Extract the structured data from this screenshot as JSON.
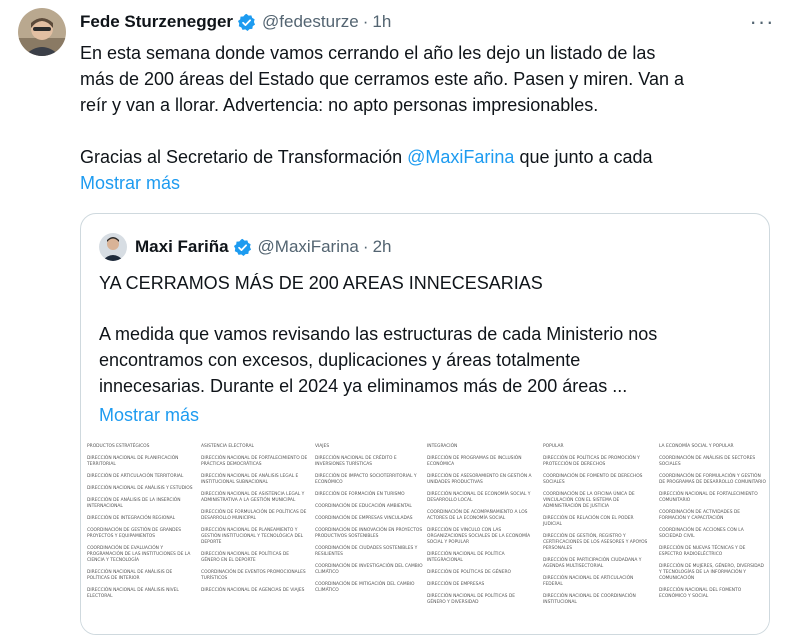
{
  "tweet": {
    "author_name": "Fede Sturzenegger",
    "handle": "@fedesturze",
    "time": "1h",
    "text_lines": [
      "En esta semana donde vamos cerrando el año les dejo un listado de las",
      "más de 200 áreas del Estado que cerramos este año. Pasen y miren. Van a",
      "reír y van a  llorar. Advertencia: no apto personas impresionables."
    ],
    "thanks_prefix": "Gracias al Secretario de Transformación ",
    "thanks_mention": "@MaxiFarina",
    "thanks_suffix": " que junto a cada",
    "show_more": "Mostrar más"
  },
  "quote": {
    "author_name": "Maxi Fariña",
    "handle": "@MaxiFarina",
    "time": "2h",
    "title": "YA CERRAMOS MÁS DE 200 AREAS INNECESARIAS",
    "body_lines": [
      "A medida que vamos revisando las estructuras de cada Ministerio nos",
      "encontramos con excesos, duplicaciones y áreas totalmente",
      "innecesarias. Durante el 2024 ya eliminamos más de 200 áreas ..."
    ],
    "show_more": "Mostrar más"
  },
  "image_columns": [
    [
      "Productos estratégicos",
      "Dirección nacional de planificación territorial",
      "Dirección de articulación territorial",
      "Dirección nacional de análisis y estudios",
      "Dirección de análisis de la inserción internacional",
      "Dirección de integración regional",
      "Coordinación de gestión de grandes proyectos y equipamientos",
      "Coordinación de evaluación y programación de las instituciones de la ciencia y tecnología",
      "Dirección nacional de análisis de políticas de interior",
      "Dirección nacional de análisis nivel electoral"
    ],
    [
      "Asistencia electoral",
      "Dirección nacional de fortalecimiento de prácticas democráticas",
      "Dirección nacional de análisis legal e institucional subnacional",
      "Dirección nacional de asistencia legal y administrativa a la gestión municipal",
      "Dirección de formulación de políticas de desarrollo municipal",
      "Dirección nacional de planeamiento y gestión institucional y tecnológica del deporte",
      "Dirección nacional de políticas de género en el deporte",
      "Coordinación de eventos promocionales turísticos",
      "Dirección nacional de agencias de viajes"
    ],
    [
      "Viajes",
      "Dirección nacional de crédito e inversiones turísticas",
      "Dirección de impacto socioterritorial y económico",
      "Dirección de formación en turismo",
      "Coordinación de educación ambiental",
      "Coordinación de empresas vinculadas",
      "Coordinación de innovación en proyectos productivos sostenibles",
      "Coordinación de ciudades sostenibles y resilientes",
      "Coordinación de investigación del cambio climático",
      "Coordinación de mitigación del cambio climático"
    ],
    [
      "Integración",
      "Dirección de programas de inclusión económica",
      "Dirección de asesoramiento en gestión a unidades productivas",
      "Dirección nacional de economía social y desarrollo local",
      "Coordinación de acompañamiento a los actores de la economía social",
      "Dirección de vinculo con las organizaciones sociales de la economía social y popular",
      "Dirección nacional de política integracional",
      "Dirección de políticas de género",
      "Dirección de empresas",
      "Dirección nacional de políticas de género y diversidad"
    ],
    [
      "Popular",
      "Dirección de políticas de promoción y protección de derechos",
      "Coordinación de fomento de derechos sociales",
      "Coordinación de la oficina única de vinculación con el sistema de administración de justicia",
      "Dirección de relación con el poder judicial",
      "Dirección de gestión, registro y certificaciones de los asesores y apoyos personales",
      "Dirección de participación ciudadana y agendas multisectorial",
      "Dirección nacional de articulación federal",
      "Dirección nacional de coordinación institucional"
    ],
    [
      "La economía social y popular",
      "Coordinación de análisis de sectores sociales",
      "Coordinación de formulación y gestión de programas de desarrollo comunitario",
      "Dirección nacional de fortalecimiento comunitario",
      "Coordinación de actividades de formación y capacitación",
      "Coordinación de acciones con la sociedad civil",
      "Dirección de nuevas técnicas y de espectro radioeléctrico",
      "Dirección de mujeres, género, diversidad y tecnologías de la información y comunicación",
      "Dirección nacional del fomento económico y social"
    ]
  ]
}
